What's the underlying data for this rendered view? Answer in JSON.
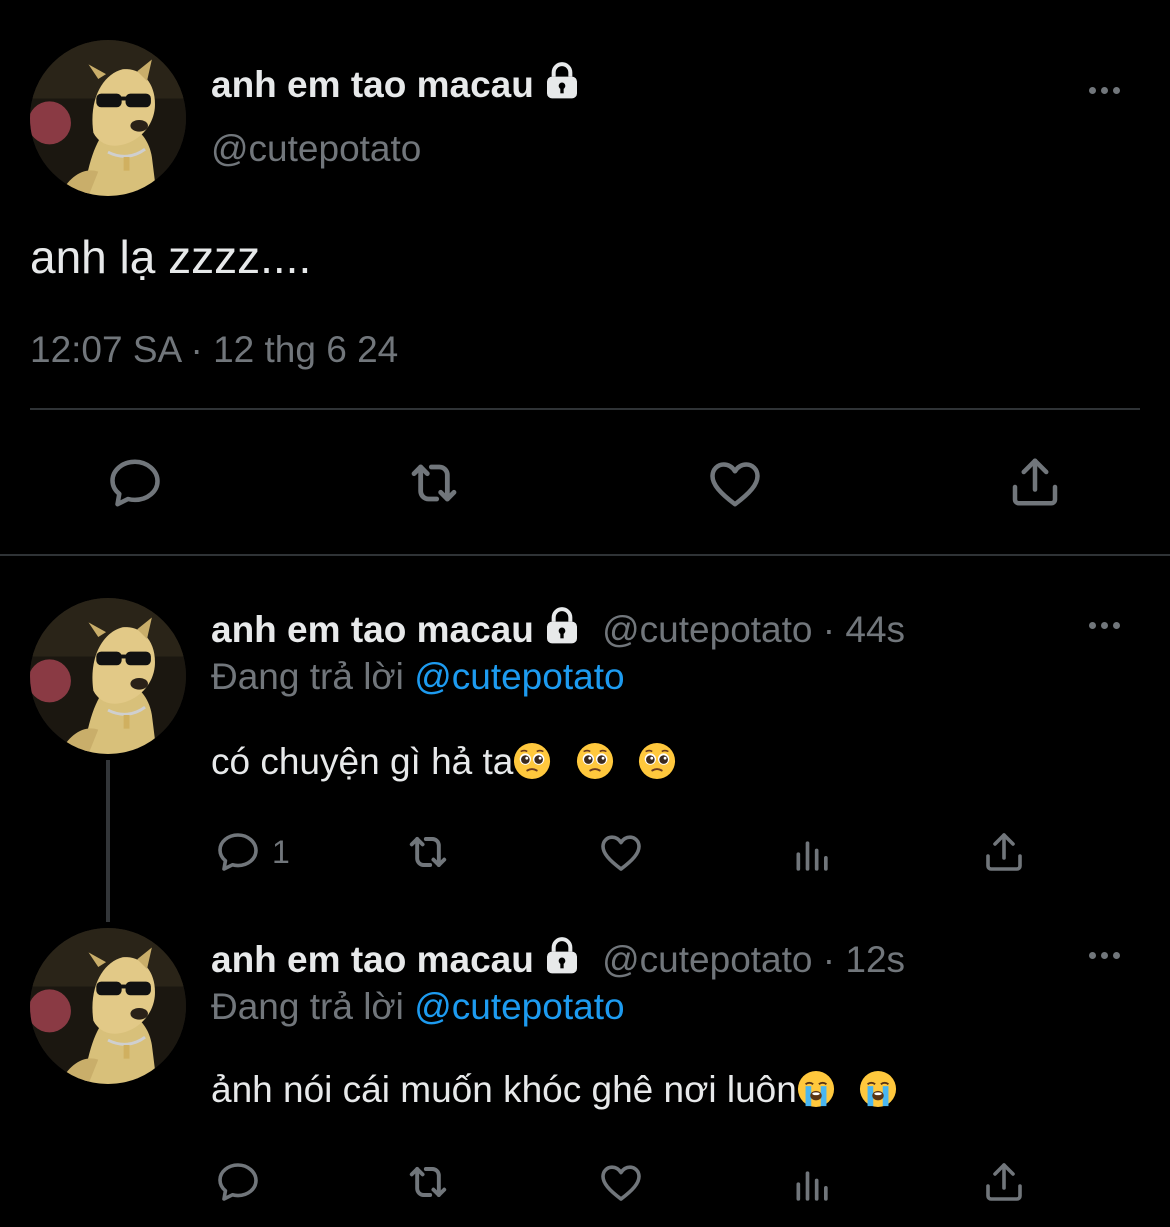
{
  "main_tweet": {
    "display_name": "anh em tao macau",
    "handle": "@cutepotato",
    "text": "anh lạ zzzz....",
    "timestamp": "12:07 SA · 12 thg 6 24"
  },
  "replies": [
    {
      "display_name": "anh em tao macau",
      "handle": "@cutepotato",
      "age": "· 44s",
      "replying_label": "Đang trả lời",
      "replying_to": "@cutepotato",
      "text": "có chuyện gì hả ta",
      "emojis": [
        "pleading-face",
        "pleading-face",
        "pleading-face"
      ],
      "reply_count": "1"
    },
    {
      "display_name": "anh em tao macau",
      "handle": "@cutepotato",
      "age": "· 12s",
      "replying_label": "Đang trả lời",
      "replying_to": "@cutepotato",
      "text": "ảnh nói cái muốn khóc ghê nơi luôn",
      "emojis": [
        "loudly-crying-face",
        "loudly-crying-face"
      ],
      "reply_count": ""
    }
  ],
  "colors": {
    "background": "#000000",
    "text": "#e7e9ea",
    "muted": "#71767b",
    "link": "#1d9bf0",
    "divider": "#2f3336"
  },
  "icons": [
    "lock-icon",
    "more-icon",
    "reply-icon",
    "retweet-icon",
    "like-icon",
    "views-icon",
    "share-icon"
  ]
}
